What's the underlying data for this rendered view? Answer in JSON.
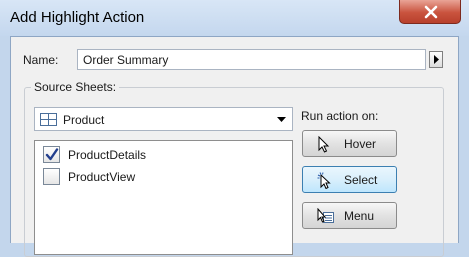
{
  "window": {
    "title": "Add Highlight Action"
  },
  "name_field": {
    "label": "Name:",
    "value": "Order Summary"
  },
  "source_sheets": {
    "group_label": "Source Sheets:",
    "selected_data_source": "Product",
    "sheets": [
      {
        "label": "ProductDetails",
        "checked": true
      },
      {
        "label": "ProductView",
        "checked": false
      }
    ]
  },
  "run_action_on": {
    "label": "Run action on:",
    "buttons": [
      {
        "label": "Hover",
        "icon": "pointer-icon",
        "selected": false
      },
      {
        "label": "Select",
        "icon": "click-pointer-icon",
        "selected": true
      },
      {
        "label": "Menu",
        "icon": "menu-pointer-icon",
        "selected": false
      }
    ]
  },
  "colors": {
    "selected_button": "#bee6fd",
    "close_button": "#c9533e"
  }
}
